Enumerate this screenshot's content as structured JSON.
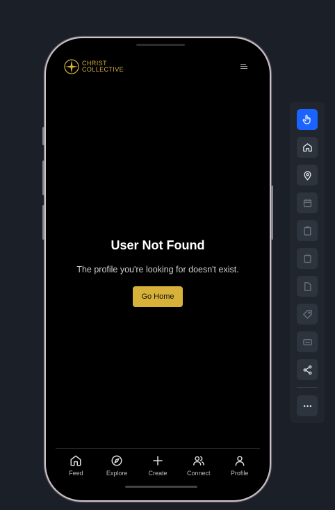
{
  "app": {
    "brand_line1": "Christ",
    "brand_line2": "Collective"
  },
  "error": {
    "title": "User Not Found",
    "message": "The profile you're looking for doesn't exist.",
    "action_label": "Go Home"
  },
  "bottom_nav": {
    "items": [
      {
        "label": "Feed",
        "icon": "home-icon"
      },
      {
        "label": "Explore",
        "icon": "compass-icon"
      },
      {
        "label": "Create",
        "icon": "plus-icon"
      },
      {
        "label": "Connect",
        "icon": "users-icon"
      },
      {
        "label": "Profile",
        "icon": "user-icon"
      }
    ]
  },
  "toolbar": {
    "tools": [
      "pointer-icon",
      "home-icon",
      "location-pin-icon",
      "calendar-icon",
      "clipboard-icon",
      "note-icon",
      "document-icon",
      "tag-icon",
      "card-icon",
      "share-icon",
      "more-icon"
    ]
  },
  "colors": {
    "accent": "#d8b13a",
    "toolbar_active": "#1a63ff"
  }
}
